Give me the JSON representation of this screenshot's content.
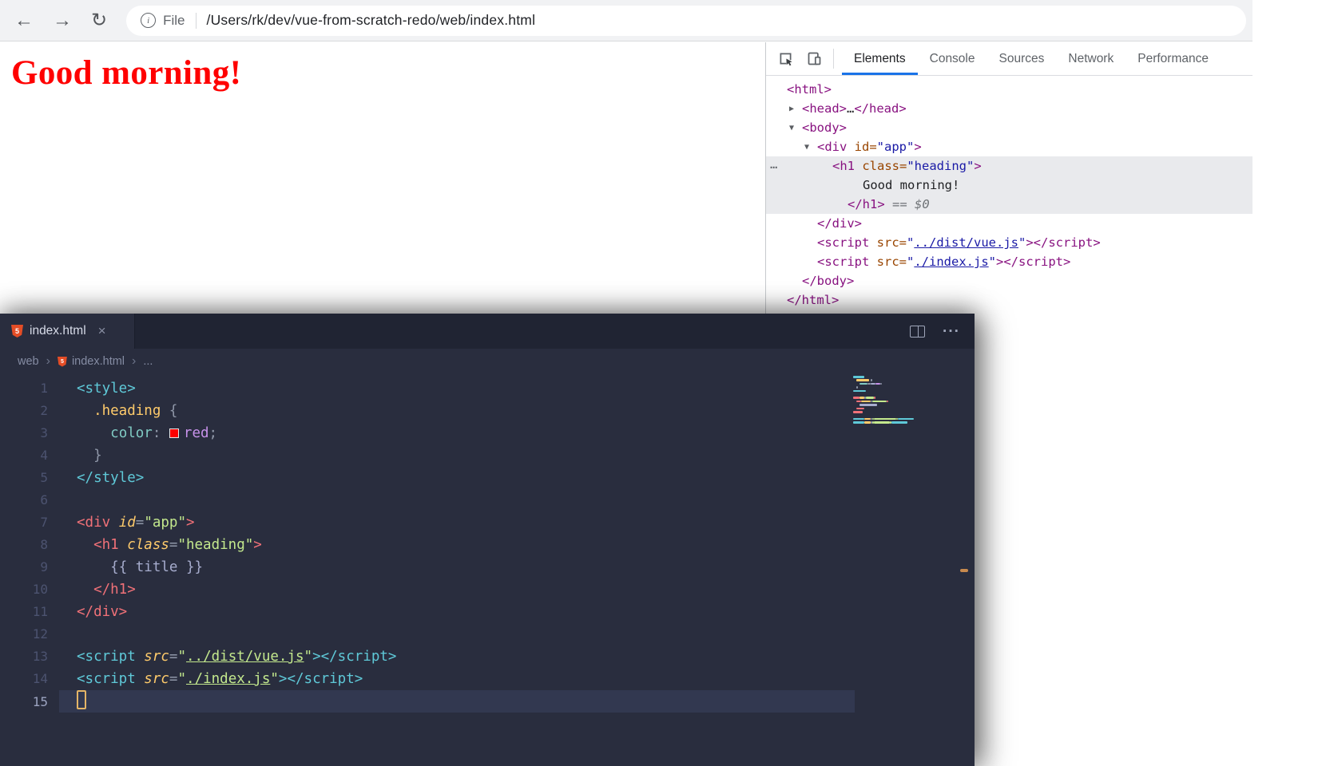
{
  "browser": {
    "toolbar": {
      "back_icon": "←",
      "forward_icon": "→",
      "reload_icon": "↻",
      "info_icon": "i",
      "scheme_label": "File",
      "address": "/Users/rk/dev/vue-from-scratch-redo/web/index.html"
    },
    "page": {
      "heading": "Good morning!",
      "heading_color": "#ff0000"
    }
  },
  "devtools": {
    "accent_color": "#1a73e8",
    "tabs": [
      {
        "label": "Elements",
        "active": true
      },
      {
        "label": "Console",
        "active": false
      },
      {
        "label": "Sources",
        "active": false
      },
      {
        "label": "Network",
        "active": false
      },
      {
        "label": "Performance",
        "active": false
      }
    ],
    "selected_badge": "…",
    "tree": [
      {
        "indent": 0,
        "tokens": [
          {
            "c": "tag",
            "t": "<html>"
          }
        ]
      },
      {
        "indent": 1,
        "arrow": "▶",
        "tokens": [
          {
            "c": "tag",
            "t": "<head>"
          },
          {
            "c": "text",
            "t": "…"
          },
          {
            "c": "tag",
            "t": "</head>"
          }
        ]
      },
      {
        "indent": 1,
        "arrow": "▼",
        "tokens": [
          {
            "c": "tag",
            "t": "<body>"
          }
        ]
      },
      {
        "indent": 2,
        "arrow": "▼",
        "tokens": [
          {
            "c": "tag",
            "t": "<div"
          },
          {
            "c": "attr",
            "t": " id="
          },
          {
            "c": "value",
            "t": "\"app\""
          },
          {
            "c": "tag",
            "t": ">"
          }
        ]
      },
      {
        "indent": 3,
        "selected": true,
        "badge": "…",
        "tokens": [
          {
            "c": "tag",
            "t": "<h1"
          },
          {
            "c": "attr",
            "t": " class="
          },
          {
            "c": "value",
            "t": "\"heading\""
          },
          {
            "c": "tag",
            "t": ">"
          }
        ]
      },
      {
        "indent": 5,
        "selected": true,
        "tokens": [
          {
            "c": "text",
            "t": "Good morning!"
          }
        ]
      },
      {
        "indent": 4,
        "selected": true,
        "tokens": [
          {
            "c": "tag",
            "t": "</h1>"
          },
          {
            "c": "meta",
            "t": " == "
          },
          {
            "c": "dollar",
            "t": "$0"
          }
        ]
      },
      {
        "indent": 2,
        "tokens": [
          {
            "c": "tag",
            "t": "</div>"
          }
        ]
      },
      {
        "indent": 2,
        "tokens": [
          {
            "c": "tag",
            "t": "<script"
          },
          {
            "c": "attr",
            "t": " src="
          },
          {
            "c": "value",
            "t": "\""
          },
          {
            "c": "link",
            "t": "../dist/vue.js"
          },
          {
            "c": "value",
            "t": "\""
          },
          {
            "c": "tag",
            "t": "></script>"
          }
        ]
      },
      {
        "indent": 2,
        "tokens": [
          {
            "c": "tag",
            "t": "<script"
          },
          {
            "c": "attr",
            "t": " src="
          },
          {
            "c": "value",
            "t": "\""
          },
          {
            "c": "link",
            "t": "./index.js"
          },
          {
            "c": "value",
            "t": "\""
          },
          {
            "c": "tag",
            "t": "></script>"
          }
        ]
      },
      {
        "indent": 1,
        "tokens": [
          {
            "c": "tag",
            "t": "</body>"
          }
        ]
      },
      {
        "indent": 0,
        "tokens": [
          {
            "c": "tag",
            "t": "</html>"
          }
        ]
      }
    ]
  },
  "editor": {
    "tab": {
      "label": "index.html",
      "close_icon": "×"
    },
    "more_icon": "···",
    "breadcrumb": {
      "items": [
        "web",
        "index.html",
        "..."
      ],
      "separator": "›"
    },
    "cursor_color": "#e5b567",
    "html_icon_color": "#e44d26",
    "lines": [
      {
        "n": 1,
        "tokens": [
          {
            "c": "tagx",
            "t": "<style>"
          }
        ]
      },
      {
        "n": 2,
        "tokens": [
          {
            "c": "plain",
            "t": "  "
          },
          {
            "c": "sel",
            "t": ".heading"
          },
          {
            "c": "plain",
            "t": " "
          },
          {
            "c": "punc",
            "t": "{"
          }
        ]
      },
      {
        "n": 3,
        "tokens": [
          {
            "c": "plain",
            "t": "    "
          },
          {
            "c": "prop",
            "t": "color"
          },
          {
            "c": "punc",
            "t": ": "
          },
          {
            "c": "swatch",
            "t": "red"
          },
          {
            "c": "val",
            "t": "red"
          },
          {
            "c": "punc",
            "t": ";"
          }
        ]
      },
      {
        "n": 4,
        "tokens": [
          {
            "c": "plain",
            "t": "  "
          },
          {
            "c": "punc",
            "t": "}"
          }
        ]
      },
      {
        "n": 5,
        "tokens": [
          {
            "c": "tagx",
            "t": "</style>"
          }
        ]
      },
      {
        "n": 6,
        "tokens": []
      },
      {
        "n": 7,
        "tokens": [
          {
            "c": "tag",
            "t": "<div"
          },
          {
            "c": "attr",
            "t": " id"
          },
          {
            "c": "punc",
            "t": "="
          },
          {
            "c": "str",
            "t": "\"app\""
          },
          {
            "c": "tag",
            "t": ">"
          }
        ]
      },
      {
        "n": 8,
        "tokens": [
          {
            "c": "plain",
            "t": "  "
          },
          {
            "c": "tag",
            "t": "<h1"
          },
          {
            "c": "attr",
            "t": " class"
          },
          {
            "c": "punc",
            "t": "="
          },
          {
            "c": "str",
            "t": "\"heading\""
          },
          {
            "c": "tag",
            "t": ">"
          }
        ]
      },
      {
        "n": 9,
        "tokens": [
          {
            "c": "plain",
            "t": "    "
          },
          {
            "c": "plain",
            "t": "{{ title }}"
          }
        ]
      },
      {
        "n": 10,
        "tokens": [
          {
            "c": "plain",
            "t": "  "
          },
          {
            "c": "tag",
            "t": "</h1>"
          }
        ]
      },
      {
        "n": 11,
        "tokens": [
          {
            "c": "tag",
            "t": "</div>"
          }
        ]
      },
      {
        "n": 12,
        "tokens": []
      },
      {
        "n": 13,
        "tokens": [
          {
            "c": "tagx",
            "t": "<script"
          },
          {
            "c": "attr",
            "t": " src"
          },
          {
            "c": "punc",
            "t": "="
          },
          {
            "c": "str",
            "t": "\""
          },
          {
            "c": "strlink",
            "t": "../dist/vue.js"
          },
          {
            "c": "str",
            "t": "\""
          },
          {
            "c": "tagx",
            "t": "></script>"
          }
        ]
      },
      {
        "n": 14,
        "tokens": [
          {
            "c": "tagx",
            "t": "<script"
          },
          {
            "c": "attr",
            "t": " src"
          },
          {
            "c": "punc",
            "t": "="
          },
          {
            "c": "str",
            "t": "\""
          },
          {
            "c": "strlink",
            "t": "./index.js"
          },
          {
            "c": "str",
            "t": "\""
          },
          {
            "c": "tagx",
            "t": "></script>"
          }
        ]
      },
      {
        "n": 15,
        "active": true,
        "tokens": [
          {
            "c": "cursor",
            "t": ""
          }
        ]
      }
    ]
  }
}
